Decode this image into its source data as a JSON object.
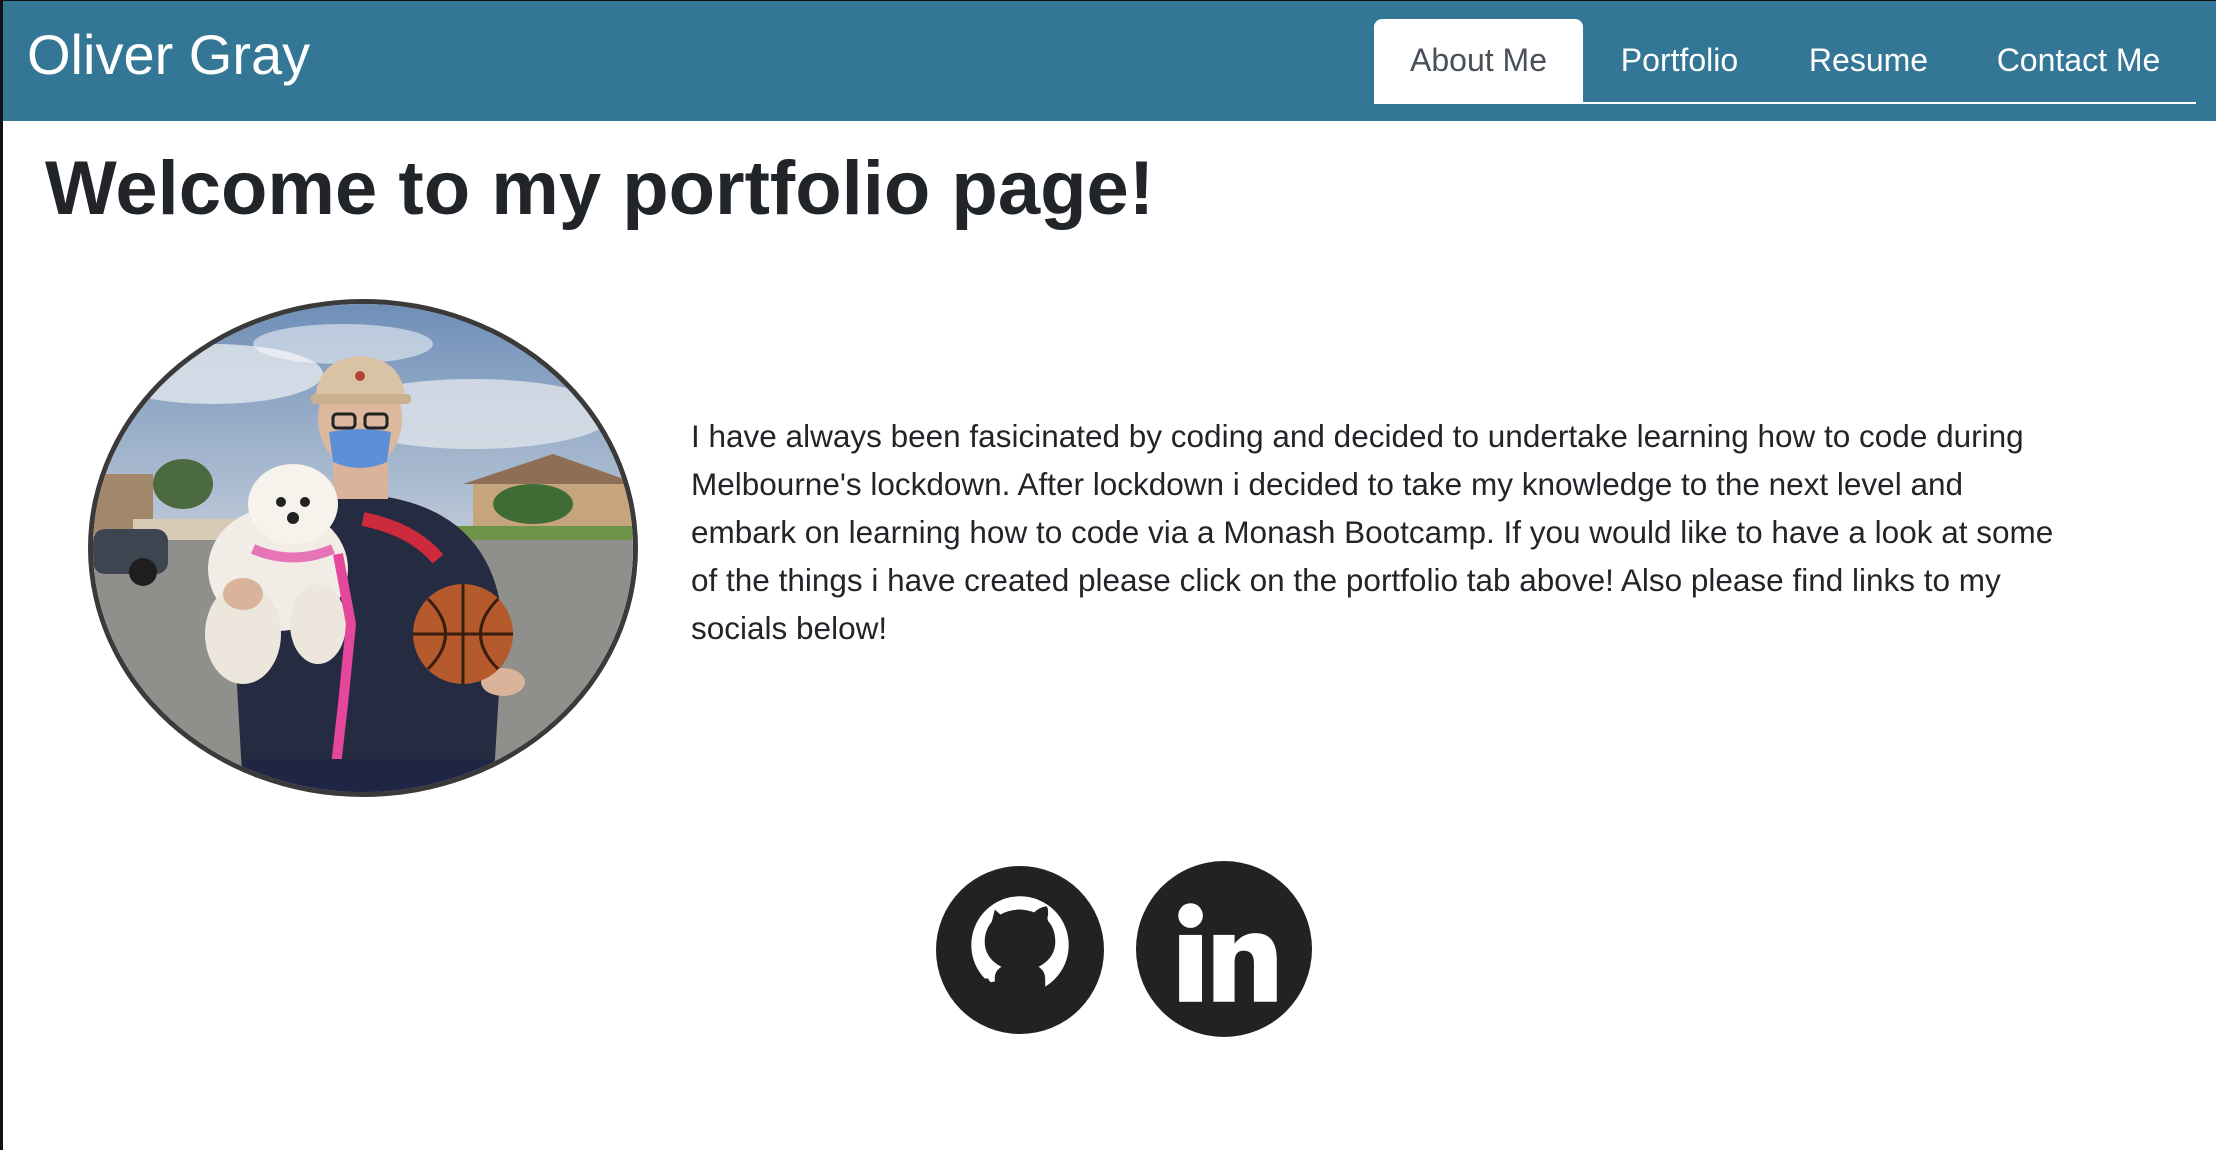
{
  "header": {
    "brand": "Oliver Gray",
    "tabs": [
      {
        "label": "About Me",
        "active": true
      },
      {
        "label": "Portfolio",
        "active": false
      },
      {
        "label": "Resume",
        "active": false
      },
      {
        "label": "Contact Me",
        "active": false
      }
    ]
  },
  "main": {
    "heading": "Welcome to my portfolio page!",
    "bio": "I have always been fasicinated by coding and decided to undertake learning how to code during Melbourne's lockdown. After lockdown i decided to take my knowledge to the next level and embark on learning how to code via a Monash Bootcamp. If you would like to have a look at some of the things i have created please click on the portfolio tab above! Also please find links to my socials below!"
  },
  "social": {
    "links": [
      {
        "icon": "github-icon"
      },
      {
        "icon": "linkedin-icon"
      }
    ]
  },
  "colors": {
    "navbar": "#337696",
    "active_tab_text": "#495057",
    "text": "#212529",
    "icon": "#222222"
  }
}
